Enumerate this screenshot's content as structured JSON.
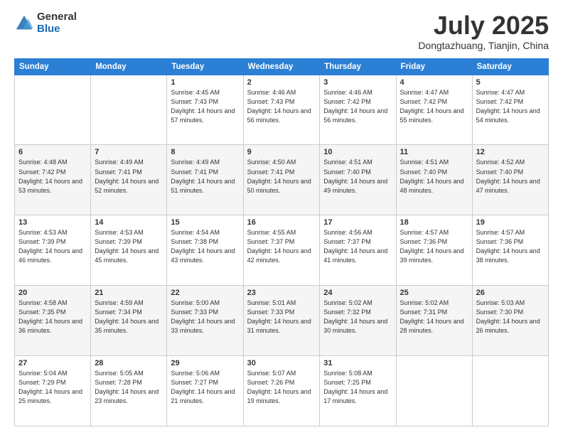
{
  "logo": {
    "general": "General",
    "blue": "Blue"
  },
  "header": {
    "month": "July 2025",
    "location": "Dongtazhuang, Tianjin, China"
  },
  "weekdays": [
    "Sunday",
    "Monday",
    "Tuesday",
    "Wednesday",
    "Thursday",
    "Friday",
    "Saturday"
  ],
  "weeks": [
    [
      {
        "day": "",
        "info": ""
      },
      {
        "day": "",
        "info": ""
      },
      {
        "day": "1",
        "info": "Sunrise: 4:45 AM\nSunset: 7:43 PM\nDaylight: 14 hours\nand 57 minutes."
      },
      {
        "day": "2",
        "info": "Sunrise: 4:46 AM\nSunset: 7:43 PM\nDaylight: 14 hours\nand 56 minutes."
      },
      {
        "day": "3",
        "info": "Sunrise: 4:46 AM\nSunset: 7:42 PM\nDaylight: 14 hours\nand 56 minutes."
      },
      {
        "day": "4",
        "info": "Sunrise: 4:47 AM\nSunset: 7:42 PM\nDaylight: 14 hours\nand 55 minutes."
      },
      {
        "day": "5",
        "info": "Sunrise: 4:47 AM\nSunset: 7:42 PM\nDaylight: 14 hours\nand 54 minutes."
      }
    ],
    [
      {
        "day": "6",
        "info": "Sunrise: 4:48 AM\nSunset: 7:42 PM\nDaylight: 14 hours\nand 53 minutes."
      },
      {
        "day": "7",
        "info": "Sunrise: 4:49 AM\nSunset: 7:41 PM\nDaylight: 14 hours\nand 52 minutes."
      },
      {
        "day": "8",
        "info": "Sunrise: 4:49 AM\nSunset: 7:41 PM\nDaylight: 14 hours\nand 51 minutes."
      },
      {
        "day": "9",
        "info": "Sunrise: 4:50 AM\nSunset: 7:41 PM\nDaylight: 14 hours\nand 50 minutes."
      },
      {
        "day": "10",
        "info": "Sunrise: 4:51 AM\nSunset: 7:40 PM\nDaylight: 14 hours\nand 49 minutes."
      },
      {
        "day": "11",
        "info": "Sunrise: 4:51 AM\nSunset: 7:40 PM\nDaylight: 14 hours\nand 48 minutes."
      },
      {
        "day": "12",
        "info": "Sunrise: 4:52 AM\nSunset: 7:40 PM\nDaylight: 14 hours\nand 47 minutes."
      }
    ],
    [
      {
        "day": "13",
        "info": "Sunrise: 4:53 AM\nSunset: 7:39 PM\nDaylight: 14 hours\nand 46 minutes."
      },
      {
        "day": "14",
        "info": "Sunrise: 4:53 AM\nSunset: 7:39 PM\nDaylight: 14 hours\nand 45 minutes."
      },
      {
        "day": "15",
        "info": "Sunrise: 4:54 AM\nSunset: 7:38 PM\nDaylight: 14 hours\nand 43 minutes."
      },
      {
        "day": "16",
        "info": "Sunrise: 4:55 AM\nSunset: 7:37 PM\nDaylight: 14 hours\nand 42 minutes."
      },
      {
        "day": "17",
        "info": "Sunrise: 4:56 AM\nSunset: 7:37 PM\nDaylight: 14 hours\nand 41 minutes."
      },
      {
        "day": "18",
        "info": "Sunrise: 4:57 AM\nSunset: 7:36 PM\nDaylight: 14 hours\nand 39 minutes."
      },
      {
        "day": "19",
        "info": "Sunrise: 4:57 AM\nSunset: 7:36 PM\nDaylight: 14 hours\nand 38 minutes."
      }
    ],
    [
      {
        "day": "20",
        "info": "Sunrise: 4:58 AM\nSunset: 7:35 PM\nDaylight: 14 hours\nand 36 minutes."
      },
      {
        "day": "21",
        "info": "Sunrise: 4:59 AM\nSunset: 7:34 PM\nDaylight: 14 hours\nand 35 minutes."
      },
      {
        "day": "22",
        "info": "Sunrise: 5:00 AM\nSunset: 7:33 PM\nDaylight: 14 hours\nand 33 minutes."
      },
      {
        "day": "23",
        "info": "Sunrise: 5:01 AM\nSunset: 7:33 PM\nDaylight: 14 hours\nand 31 minutes."
      },
      {
        "day": "24",
        "info": "Sunrise: 5:02 AM\nSunset: 7:32 PM\nDaylight: 14 hours\nand 30 minutes."
      },
      {
        "day": "25",
        "info": "Sunrise: 5:02 AM\nSunset: 7:31 PM\nDaylight: 14 hours\nand 28 minutes."
      },
      {
        "day": "26",
        "info": "Sunrise: 5:03 AM\nSunset: 7:30 PM\nDaylight: 14 hours\nand 26 minutes."
      }
    ],
    [
      {
        "day": "27",
        "info": "Sunrise: 5:04 AM\nSunset: 7:29 PM\nDaylight: 14 hours\nand 25 minutes."
      },
      {
        "day": "28",
        "info": "Sunrise: 5:05 AM\nSunset: 7:28 PM\nDaylight: 14 hours\nand 23 minutes."
      },
      {
        "day": "29",
        "info": "Sunrise: 5:06 AM\nSunset: 7:27 PM\nDaylight: 14 hours\nand 21 minutes."
      },
      {
        "day": "30",
        "info": "Sunrise: 5:07 AM\nSunset: 7:26 PM\nDaylight: 14 hours\nand 19 minutes."
      },
      {
        "day": "31",
        "info": "Sunrise: 5:08 AM\nSunset: 7:25 PM\nDaylight: 14 hours\nand 17 minutes."
      },
      {
        "day": "",
        "info": ""
      },
      {
        "day": "",
        "info": ""
      }
    ]
  ]
}
